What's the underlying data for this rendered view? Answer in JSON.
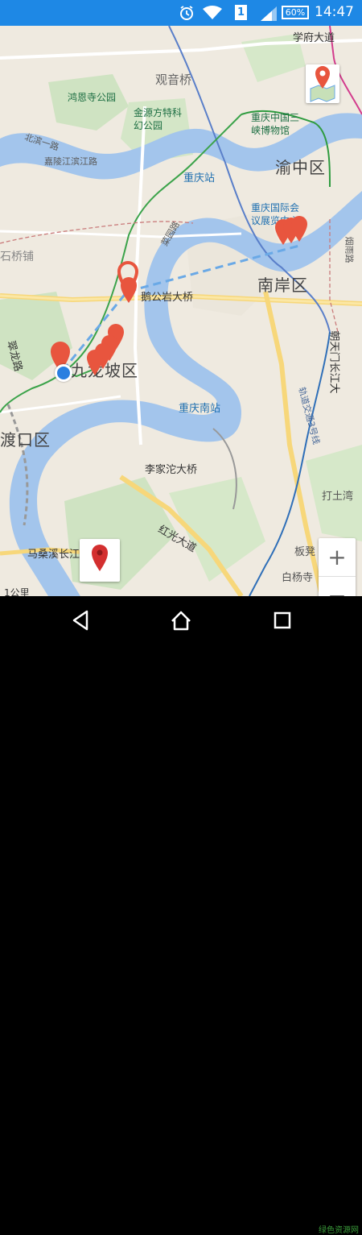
{
  "status_bar": {
    "time": "14:47",
    "battery": "60%",
    "sim": "1",
    "icons": [
      "alarm-icon",
      "wifi-icon",
      "sim-icon",
      "signal-icon",
      "battery-icon"
    ]
  },
  "map": {
    "districts": [
      "渝中区",
      "南岸区",
      "九龙坡区",
      "渡口区"
    ],
    "roads": [
      "北滨一路",
      "嘉陵江滨江路",
      "鹅公岩大桥",
      "李家沱大桥",
      "红光大道",
      "马桑溪长江",
      "学府大道",
      "朝天门长江大",
      "烟雨路",
      "翠龙路",
      "菜园路"
    ],
    "pois": [
      "鸿恩寺公园",
      "金源方特科幻公园",
      "重庆中国三峡博物馆",
      "重庆国际会议展览中心",
      "观音桥"
    ],
    "stations": [
      "重庆站",
      "重庆南站"
    ],
    "rail": "轨道交通3号线",
    "places": [
      "打土湾",
      "板凳",
      "白杨寺",
      "石桥铺"
    ],
    "scale": "1公里"
  },
  "controls": {
    "zoom_in": "+",
    "zoom_out": "−",
    "location_icon": "map-pin-icon"
  },
  "watermark": "绿色资源网",
  "colors": {
    "status_bar": "#1e88e5",
    "water": "#a3c5ec",
    "marker": "#e8553e",
    "current_location": "#2a7fe0",
    "route_dash": "#6aa9e6"
  }
}
